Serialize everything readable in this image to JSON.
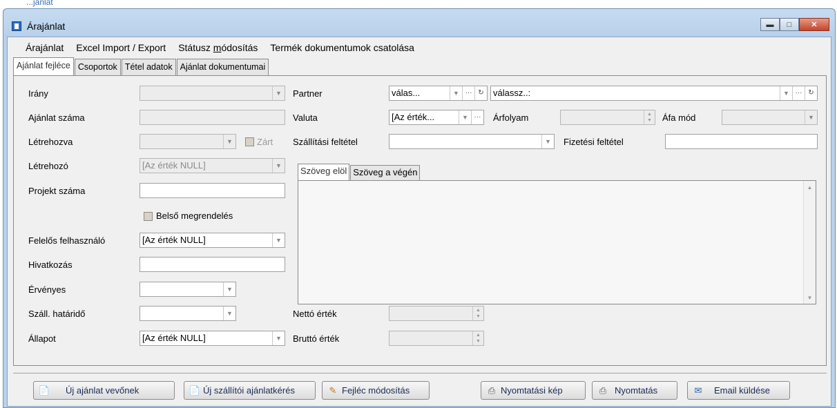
{
  "window": {
    "title": "Árajánlat",
    "strip_text": "...jánlat"
  },
  "menu": {
    "items": [
      {
        "label": "Árajánlat"
      },
      {
        "label_before": "Excel Import / Export",
        "label": "Excel Import / Export"
      },
      {
        "label_a": "Státusz ",
        "label_b": "m",
        "label_c": "ódosítás"
      },
      {
        "label": "Termék dokumentumok csatolása"
      }
    ]
  },
  "tabs": [
    {
      "label": "Ajánlat fejléce",
      "active": true
    },
    {
      "label": "Csoportok"
    },
    {
      "label": "Tétel adatok"
    },
    {
      "label": "Ajánlat dokumentumai"
    }
  ],
  "left": {
    "irany": {
      "label": "Irány",
      "value": ""
    },
    "ajanlat_szama": {
      "label": "Ajánlat száma",
      "value": ""
    },
    "letrehozva": {
      "label": "Létrehozva",
      "value": "",
      "zart_label": "Zárt"
    },
    "letrehozo": {
      "label": "Létrehozó",
      "value": "[Az érték NULL]"
    },
    "projekt_szama": {
      "label": "Projekt száma",
      "value": ""
    },
    "belso": {
      "label": "Belső megrendelés"
    },
    "felelos": {
      "label": "Felelős felhasználó",
      "value": "[Az érték NULL]"
    },
    "hivatkozas": {
      "label": "Hivatkozás",
      "value": ""
    },
    "ervenyes": {
      "label": "Érvényes",
      "value": ""
    },
    "szall_hatarido": {
      "label": "Száll. határidő",
      "value": ""
    },
    "allapot": {
      "label": "Állapot",
      "value": "[Az érték NULL]"
    }
  },
  "right": {
    "partner": {
      "label": "Partner",
      "value_short": "válas...",
      "value_long": "válassz..:"
    },
    "valuta": {
      "label": "Valuta",
      "value": "[Az érték..."
    },
    "arfolyam": {
      "label": "Árfolyam",
      "value": ""
    },
    "afa_mod": {
      "label": "Áfa mód",
      "value": ""
    },
    "szallitasi_feltetel": {
      "label": "Szállítási feltétel",
      "value": ""
    },
    "fizetesi_feltetel": {
      "label": "Fizetési feltétel",
      "value": ""
    },
    "netto": {
      "label": "Nettó érték",
      "value": ""
    },
    "brutto": {
      "label": "Bruttó érték",
      "value": ""
    }
  },
  "text_tabs": [
    {
      "label": "Szöveg elöl",
      "active": true
    },
    {
      "label": "Szöveg a végén"
    }
  ],
  "buttons": [
    {
      "label": "Új ajánlat vevőnek",
      "icon": "new-offer-icon"
    },
    {
      "label": "Új szállítói ajánlatkérés",
      "icon": "new-supplier-request-icon"
    },
    {
      "label": "Fejléc módosítás",
      "icon": "edit-header-icon"
    },
    {
      "label": "Nyomtatási kép",
      "icon": "print-preview-icon"
    },
    {
      "label": "Nyomtatás",
      "icon": "print-icon"
    },
    {
      "label": "Email küldése",
      "icon": "email-icon"
    }
  ],
  "colors": {
    "accent": "#2b5fa8",
    "title_bar": "#b9d1ea",
    "close_button": "#c3452c"
  }
}
